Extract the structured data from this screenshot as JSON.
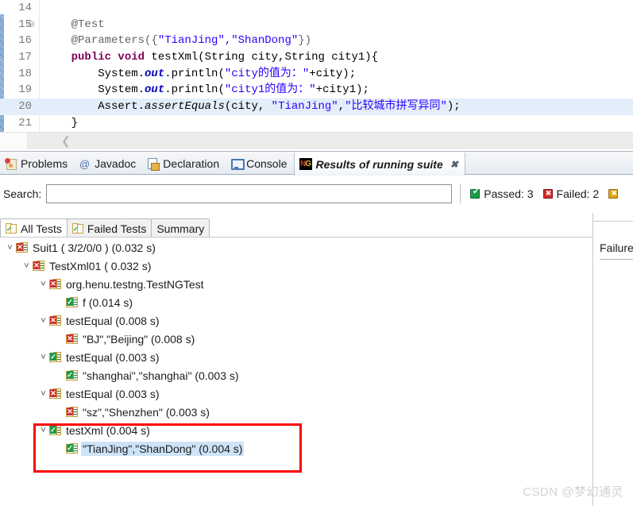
{
  "editor": {
    "lines": [
      {
        "num": "14",
        "fold": "",
        "highlight": false,
        "tokens": []
      },
      {
        "num": "15",
        "fold": "⊖",
        "highlight": false,
        "tokens": [
          {
            "t": "    ",
            "c": "k-pl"
          },
          {
            "t": "@Test",
            "c": "k-ann"
          }
        ]
      },
      {
        "num": "16",
        "fold": "",
        "highlight": false,
        "tokens": [
          {
            "t": "    ",
            "c": "k-pl"
          },
          {
            "t": "@Parameters({",
            "c": "k-ann"
          },
          {
            "t": "\"TianJing\",\"ShanDong\"",
            "c": "k-str"
          },
          {
            "t": "})",
            "c": "k-ann"
          }
        ]
      },
      {
        "num": "17",
        "fold": "",
        "highlight": false,
        "tokens": [
          {
            "t": "    ",
            "c": "k-pl"
          },
          {
            "t": "public void",
            "c": "k-kw"
          },
          {
            "t": " testXml(String city,String city1){",
            "c": "k-pl"
          }
        ]
      },
      {
        "num": "18",
        "fold": "",
        "highlight": false,
        "tokens": [
          {
            "t": "        System.",
            "c": "k-pl"
          },
          {
            "t": "out",
            "c": "k-fld"
          },
          {
            "t": ".println(",
            "c": "k-pl"
          },
          {
            "t": "\"city的值为：\"",
            "c": "k-str"
          },
          {
            "t": "+city);",
            "c": "k-pl"
          }
        ]
      },
      {
        "num": "19",
        "fold": "",
        "highlight": false,
        "tokens": [
          {
            "t": "        System.",
            "c": "k-pl"
          },
          {
            "t": "out",
            "c": "k-fld"
          },
          {
            "t": ".println(",
            "c": "k-pl"
          },
          {
            "t": "\"city1的值为：\"",
            "c": "k-str"
          },
          {
            "t": "+city1);",
            "c": "k-pl"
          }
        ]
      },
      {
        "num": "20",
        "fold": "",
        "highlight": true,
        "tokens": [
          {
            "t": "        Assert.",
            "c": "k-pl"
          },
          {
            "t": "assertEquals",
            "c": "k-mth"
          },
          {
            "t": "(city, ",
            "c": "k-pl"
          },
          {
            "t": "\"TianJing\"",
            "c": "k-str"
          },
          {
            "t": ",",
            "c": "k-pl"
          },
          {
            "t": "\"比较城市拼写异同\"",
            "c": "k-str"
          },
          {
            "t": ");",
            "c": "k-pl"
          }
        ]
      },
      {
        "num": "21",
        "fold": "",
        "highlight": false,
        "tokens": [
          {
            "t": "    }",
            "c": "k-pl"
          }
        ]
      }
    ]
  },
  "view_tabs": [
    {
      "label": "Problems",
      "icon": "problems-icon",
      "active": false
    },
    {
      "label": "Javadoc",
      "icon": "javadoc-icon",
      "active": false
    },
    {
      "label": "Declaration",
      "icon": "declaration-icon",
      "active": false
    },
    {
      "label": "Console",
      "icon": "console-icon",
      "active": false
    },
    {
      "label": "Results of running suite",
      "icon": "testng-icon",
      "active": true,
      "close": "✖"
    }
  ],
  "search": {
    "label": "Search:",
    "value": "",
    "placeholder": ""
  },
  "stats": [
    {
      "label": "Passed: 3",
      "kind": "pass"
    },
    {
      "label": "Failed: 2",
      "kind": "fail"
    },
    {
      "label": "",
      "kind": "skip"
    }
  ],
  "result_tabs": [
    {
      "label": "All Tests",
      "icon": "suite-icon",
      "active": true
    },
    {
      "label": "Failed Tests",
      "icon": "suite-icon",
      "active": false
    },
    {
      "label": "Summary",
      "icon": "",
      "active": false
    }
  ],
  "tree": [
    {
      "indent": 0,
      "twisty": "˅",
      "status": "fail",
      "label": "Suit1  ( 3/2/0/0 )  (0.032 s)",
      "selected": false
    },
    {
      "indent": 1,
      "twisty": "˅",
      "status": "fail",
      "label": "TestXml01  ( 0.032 s)",
      "selected": false
    },
    {
      "indent": 2,
      "twisty": "˅",
      "status": "fail",
      "label": "org.henu.testng.TestNGTest",
      "selected": false
    },
    {
      "indent": 3,
      "twisty": "",
      "status": "pass",
      "label": "f  (0.014 s)",
      "selected": false
    },
    {
      "indent": 2,
      "twisty": "˅",
      "status": "fail",
      "label": "testEqual  (0.008 s)",
      "selected": false
    },
    {
      "indent": 3,
      "twisty": "",
      "status": "fail",
      "label": "\"BJ\",\"Beijing\"  (0.008 s)",
      "selected": false
    },
    {
      "indent": 2,
      "twisty": "˅",
      "status": "pass",
      "label": "testEqual  (0.003 s)",
      "selected": false
    },
    {
      "indent": 3,
      "twisty": "",
      "status": "pass",
      "label": "\"shanghai\",\"shanghai\"  (0.003 s)",
      "selected": false
    },
    {
      "indent": 2,
      "twisty": "˅",
      "status": "fail",
      "label": "testEqual  (0.003 s)",
      "selected": false
    },
    {
      "indent": 3,
      "twisty": "",
      "status": "fail",
      "label": "\"sz\",\"Shenzhen\"  (0.003 s)",
      "selected": false
    },
    {
      "indent": 2,
      "twisty": "˅",
      "status": "pass",
      "label": "testXml  (0.004 s)",
      "selected": false
    },
    {
      "indent": 3,
      "twisty": "",
      "status": "pass",
      "label": "\"TianJing\",\"ShanDong\"  (0.004 s)",
      "selected": true
    }
  ],
  "right_panel": {
    "title": "Failure"
  },
  "watermark": "CSDN @梦幻通灵",
  "colors": {
    "selection": "#cde3f7",
    "code_highlight": "#e4eefa",
    "annotation_box": "#ff0000",
    "passed": "#1f9a4d",
    "failed": "#cf2e2e",
    "skipped": "#e2a515",
    "string_literal": "#2a00ff",
    "keyword": "#7f0055"
  }
}
